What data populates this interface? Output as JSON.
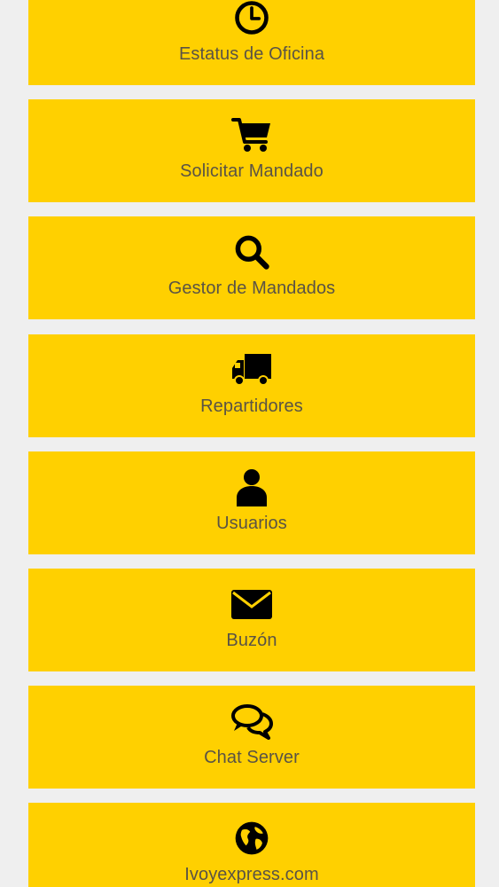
{
  "colors": {
    "background": "#efefef",
    "tile": "#ffd000",
    "label": "#5a5345",
    "icon": "#000000"
  },
  "menu": {
    "items": [
      {
        "label": "Estatus de Oficina",
        "icon": "clock-icon"
      },
      {
        "label": "Solicitar Mandado",
        "icon": "cart-icon"
      },
      {
        "label": "Gestor de Mandados",
        "icon": "search-icon"
      },
      {
        "label": "Repartidores",
        "icon": "truck-icon"
      },
      {
        "label": "Usuarios",
        "icon": "user-icon"
      },
      {
        "label": "Buzón",
        "icon": "envelope-icon"
      },
      {
        "label": "Chat Server",
        "icon": "chat-icon"
      },
      {
        "label": "Ivoyexpress.com",
        "icon": "globe-icon"
      }
    ]
  }
}
